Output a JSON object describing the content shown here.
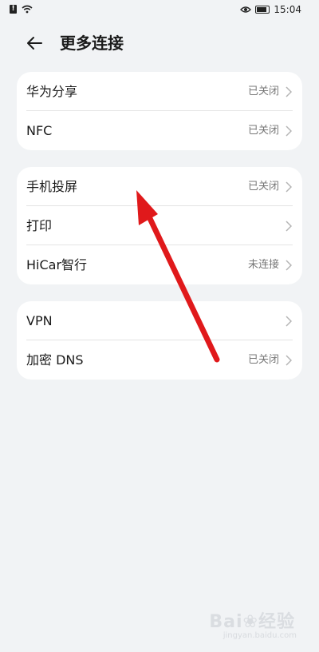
{
  "status_bar": {
    "time": "15:04",
    "alert": "!"
  },
  "header": {
    "title": "更多连接"
  },
  "groups": [
    {
      "rows": [
        {
          "label": "华为分享",
          "value": "已关闭"
        },
        {
          "label": "NFC",
          "value": "已关闭"
        }
      ]
    },
    {
      "rows": [
        {
          "label": "手机投屏",
          "value": "已关闭"
        },
        {
          "label": "打印",
          "value": ""
        },
        {
          "label": "HiCar智行",
          "value": "未连接"
        }
      ]
    },
    {
      "rows": [
        {
          "label": "VPN",
          "value": ""
        },
        {
          "label": "加密 DNS",
          "value": "已关闭"
        }
      ]
    }
  ],
  "annotation": {
    "arrow_color": "#e0191b"
  },
  "watermark": {
    "text": "Bai",
    "suffix": "经验",
    "url": "jingyan.baidu.com"
  }
}
